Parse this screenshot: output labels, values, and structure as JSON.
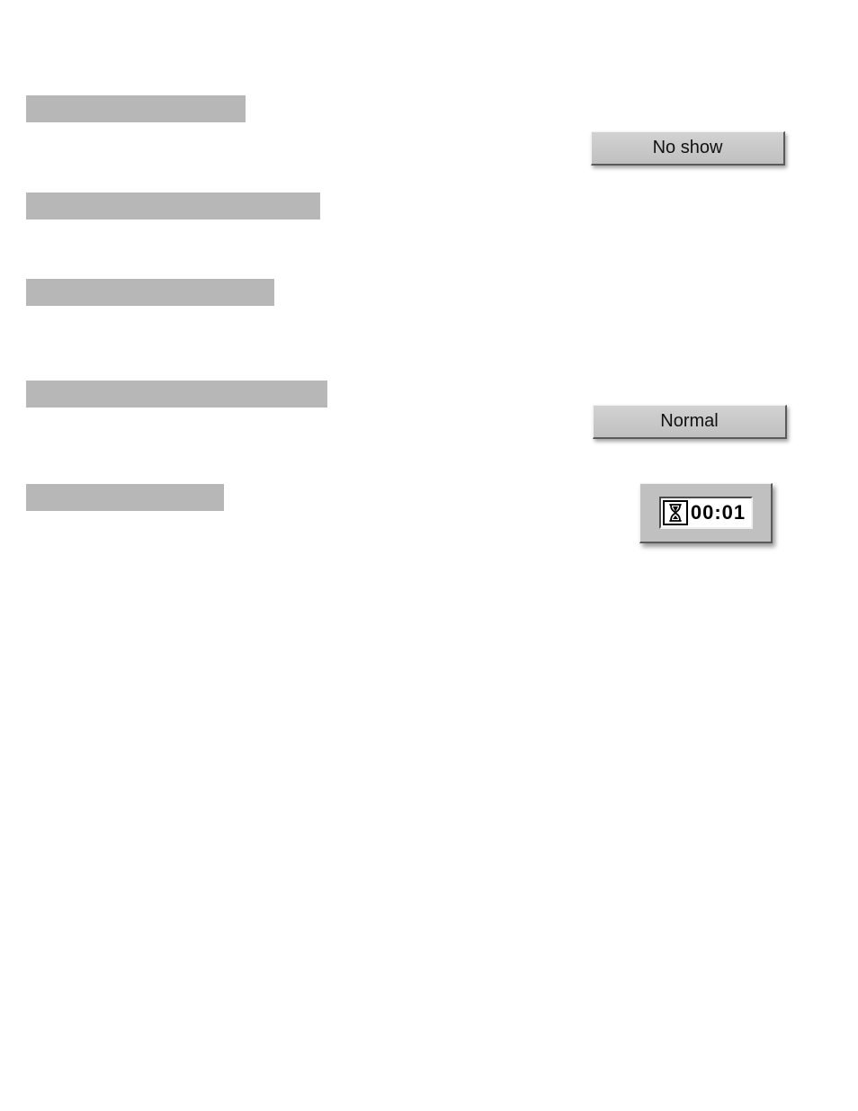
{
  "buttons": {
    "no_show": "No show",
    "normal": "Normal"
  },
  "timer": {
    "value": "00:01",
    "icon": "hourglass-icon"
  }
}
